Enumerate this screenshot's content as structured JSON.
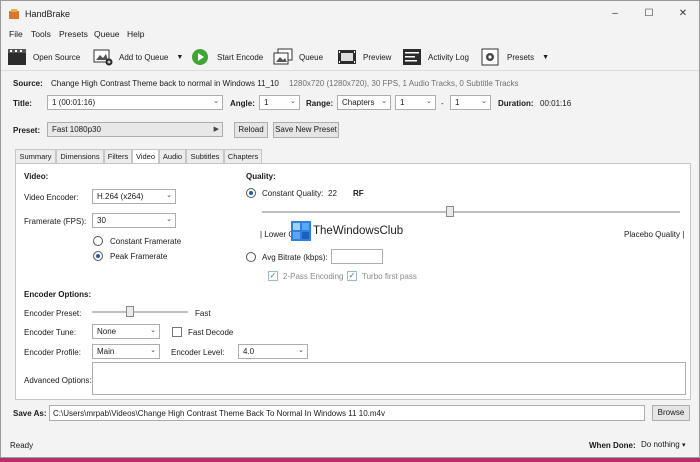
{
  "window": {
    "title": "HandBrake",
    "controls": {
      "minimize": "–",
      "maximize": "☐",
      "close": "✕"
    }
  },
  "menu": [
    "File",
    "Tools",
    "Presets",
    "Queue",
    "Help"
  ],
  "toolbar": {
    "open_source": "Open Source",
    "add_to_queue": "Add to Queue",
    "start_encode": "Start Encode",
    "queue": "Queue",
    "preview": "Preview",
    "activity_log": "Activity Log",
    "presets": "Presets"
  },
  "source": {
    "label": "Source:",
    "name": "Change High Contrast Theme back to normal in Windows 11_10",
    "info": "1280x720 (1280x720), 30 FPS, 1 Audio Tracks, 0 Subtitle Tracks"
  },
  "title_row": {
    "title_label": "Title:",
    "title_value": "1 (00:01:16)",
    "angle_label": "Angle:",
    "angle_value": "1",
    "range_label": "Range:",
    "range_value": "Chapters",
    "range_from": "1",
    "range_sep": "-",
    "range_to": "1",
    "duration_label": "Duration:",
    "duration_value": "00:01:16"
  },
  "preset_row": {
    "label": "Preset:",
    "value": "Fast 1080p30",
    "reload": "Reload",
    "save_new": "Save New Preset"
  },
  "tabs": [
    "Summary",
    "Dimensions",
    "Filters",
    "Video",
    "Audio",
    "Subtitles",
    "Chapters"
  ],
  "active_tab": "Video",
  "video": {
    "heading": "Video:",
    "encoder_label": "Video Encoder:",
    "encoder_value": "H.264 (x264)",
    "framerate_label": "Framerate (FPS):",
    "framerate_value": "30",
    "constant_framerate": "Constant Framerate",
    "peak_framerate": "Peak Framerate",
    "peak_selected": true
  },
  "quality": {
    "heading": "Quality:",
    "constant_quality_label": "Constant Quality:",
    "constant_quality_value": "22",
    "rf_label": "RF",
    "slider_position_pct": 45,
    "lower_quality": "| Lower Q",
    "placebo_quality": "Placebo Quality |",
    "avg_bitrate_label": "Avg Bitrate (kbps):",
    "two_pass": "2-Pass Encoding",
    "turbo": "Turbo first pass"
  },
  "encoder_options": {
    "heading": "Encoder Options:",
    "preset_label": "Encoder Preset:",
    "preset_value": "Fast",
    "preset_slider_pct": 40,
    "tune_label": "Encoder Tune:",
    "tune_value": "None",
    "fast_decode": "Fast Decode",
    "profile_label": "Encoder Profile:",
    "profile_value": "Main",
    "level_label": "Encoder Level:",
    "level_value": "4.0",
    "advanced_label": "Advanced Options:"
  },
  "save_as": {
    "label": "Save As:",
    "path": "C:\\Users\\mrpab\\Videos\\Change High Contrast Theme Back To Normal In Windows 11 10.m4v",
    "browse": "Browse"
  },
  "status": {
    "text": "Ready",
    "when_done_label": "When Done:",
    "when_done_value": "Do nothing"
  },
  "watermark": "TheWindowsClub",
  "colors": {
    "accent": "#1a5fb4",
    "play_green": "#3fa535",
    "background": "#b8306a"
  }
}
